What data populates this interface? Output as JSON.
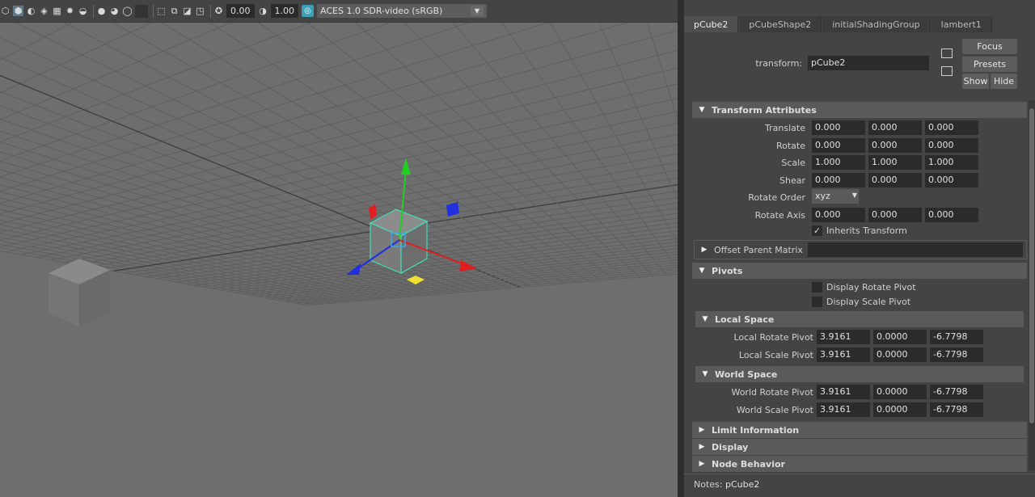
{
  "toolbar": {
    "field1": "0.00",
    "field2": "1.00",
    "color_space": "ACES 1.0 SDR-video (sRGB)"
  },
  "ae": {
    "tabs": [
      "pCube2",
      "pCubeShape2",
      "initialShadingGroup",
      "lambert1"
    ],
    "transform_label": "transform:",
    "transform_name": "pCube2",
    "buttons": {
      "focus": "Focus",
      "presets": "Presets",
      "show": "Show",
      "hide": "Hide"
    },
    "sections": {
      "transform": "Transform Attributes",
      "offset": "Offset Parent Matrix",
      "pivots": "Pivots",
      "local_space": "Local Space",
      "world_space": "World Space",
      "limit": "Limit Information",
      "display": "Display",
      "node_behavior": "Node Behavior"
    },
    "transform_rows": [
      {
        "label": "Translate",
        "values": [
          "0.000",
          "0.000",
          "0.000"
        ]
      },
      {
        "label": "Rotate",
        "values": [
          "0.000",
          "0.000",
          "0.000"
        ]
      },
      {
        "label": "Scale",
        "values": [
          "1.000",
          "1.000",
          "1.000"
        ]
      },
      {
        "label": "Shear",
        "values": [
          "0.000",
          "0.000",
          "0.000"
        ]
      }
    ],
    "rotate_order_label": "Rotate Order",
    "rotate_order_value": "xyz",
    "rotate_axis": {
      "label": "Rotate Axis",
      "values": [
        "0.000",
        "0.000",
        "0.000"
      ]
    },
    "inherits_transform": "Inherits Transform",
    "display_rotate_pivot": "Display Rotate Pivot",
    "display_scale_pivot": "Display Scale Pivot",
    "local_rows": [
      {
        "label": "Local Rotate Pivot",
        "values": [
          "3.9161",
          "0.0000",
          "-6.7798"
        ]
      },
      {
        "label": "Local Scale Pivot",
        "values": [
          "3.9161",
          "0.0000",
          "-6.7798"
        ]
      }
    ],
    "world_rows": [
      {
        "label": "World Rotate Pivot",
        "values": [
          "3.9161",
          "0.0000",
          "-6.7798"
        ]
      },
      {
        "label": "World Scale Pivot",
        "values": [
          "3.9161",
          "0.0000",
          "-6.7798"
        ]
      }
    ],
    "notes_label": "Notes:",
    "notes_value": "pCube2"
  },
  "colors": {
    "viewport_bg": "#6e6e6e",
    "grid_line": "#5f5f5f",
    "grid_axis": "#404040",
    "selection": "#3ee0b8",
    "axis_x": "#e02020",
    "axis_y": "#20d020",
    "axis_z": "#2030e0"
  }
}
